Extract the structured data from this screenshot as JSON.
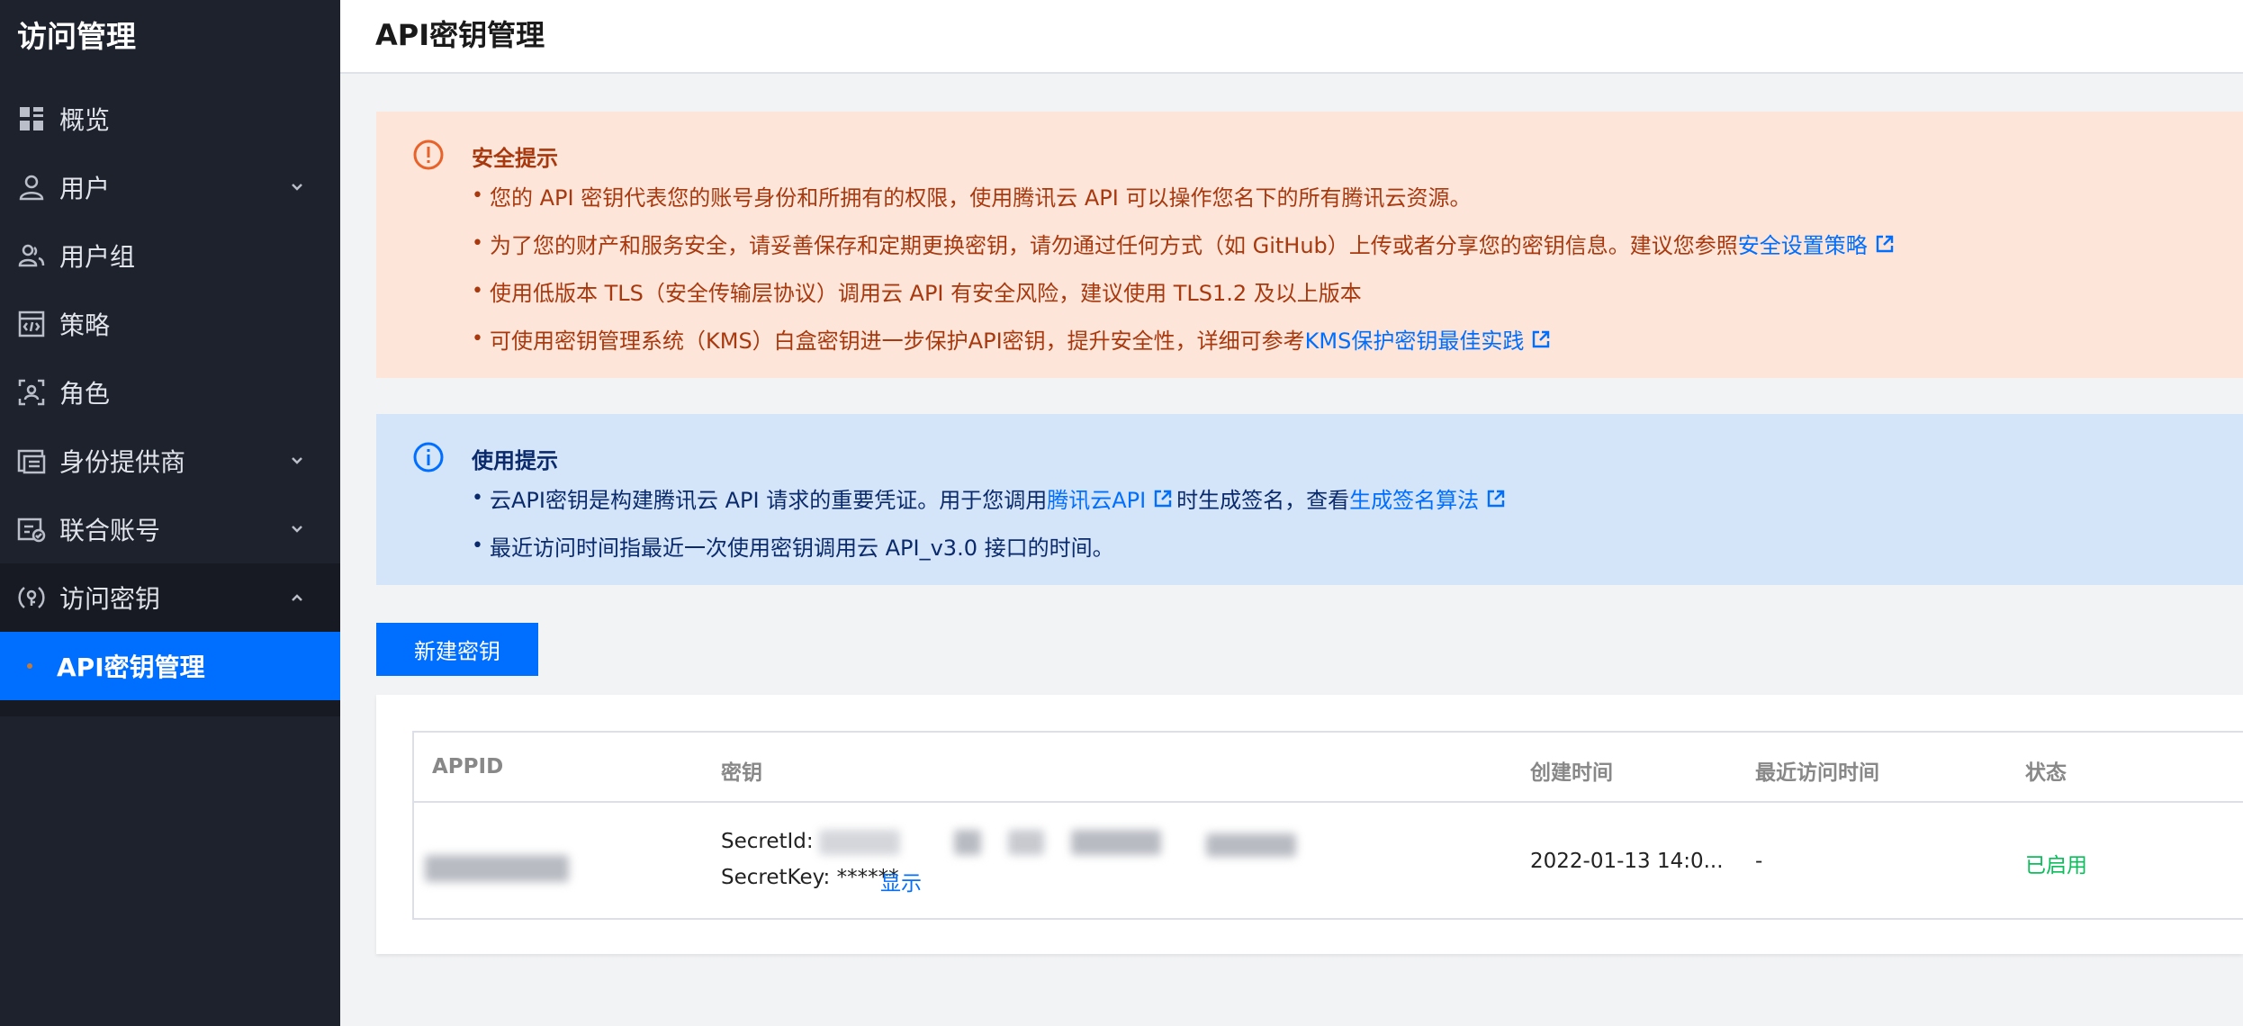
{
  "sidebar": {
    "title": "访问管理",
    "items": [
      {
        "label": "概览",
        "icon": "grid-icon"
      },
      {
        "label": "用户",
        "icon": "user-icon",
        "chevron": "down"
      },
      {
        "label": "用户组",
        "icon": "user-group-icon"
      },
      {
        "label": "策略",
        "icon": "policy-icon"
      },
      {
        "label": "角色",
        "icon": "role-icon"
      },
      {
        "label": "身份提供商",
        "icon": "identity-provider-icon",
        "chevron": "down"
      },
      {
        "label": "联合账号",
        "icon": "federated-account-icon",
        "chevron": "down"
      },
      {
        "label": "访问密钥",
        "icon": "access-key-icon",
        "chevron": "up"
      }
    ],
    "sub_item": {
      "label": "API密钥管理"
    }
  },
  "header": {
    "title": "API密钥管理"
  },
  "security_alert": {
    "title": "安全提示",
    "lines": [
      {
        "text": "您的 API 密钥代表您的账号身份和所拥有的权限，使用腾讯云 API 可以操作您名下的所有腾讯云资源。"
      },
      {
        "text": "为了您的财产和服务安全，请妥善保存和定期更换密钥，请勿通过任何方式（如 GitHub）上传或者分享您的密钥信息。建议您参照",
        "link": "安全设置策略"
      },
      {
        "text": "使用低版本 TLS（安全传输层协议）调用云 API 有安全风险，建议使用 TLS1.2 及以上版本"
      },
      {
        "text": "可使用密钥管理系统（KMS）白盒密钥进一步保护API密钥，提升安全性，详细可参考",
        "link": "KMS保护密钥最佳实践"
      }
    ],
    "colors": {
      "background": "#fde5d9",
      "text": "#a8390e",
      "icon": "#e8632a"
    }
  },
  "usage_tips": {
    "title": "使用提示",
    "line1": {
      "before": "云API密钥是构建腾讯云 API 请求的重要凭证。用于您调用",
      "link1": "腾讯云API",
      "middle": "时生成签名，查看",
      "link2": "生成签名算法"
    },
    "line2": {
      "text": "最近访问时间指最近一次使用密钥调用云 API_v3.0 接口的时间。"
    },
    "colors": {
      "background": "#d4e5fa",
      "text": "#0a2a6b",
      "icon": "#006eff"
    }
  },
  "new_key_button": "新建密钥",
  "table": {
    "columns": [
      "APPID",
      "密钥",
      "创建时间",
      "最近访问时间",
      "状态"
    ],
    "rows": [
      {
        "secret_id_label": "SecretId:",
        "secret_key_label": "SecretKey: ******",
        "show_link": "显示",
        "created": "2022-01-13 14:0...",
        "last_access": "-",
        "status": "已启用"
      }
    ]
  },
  "accent_color": "#006eff"
}
